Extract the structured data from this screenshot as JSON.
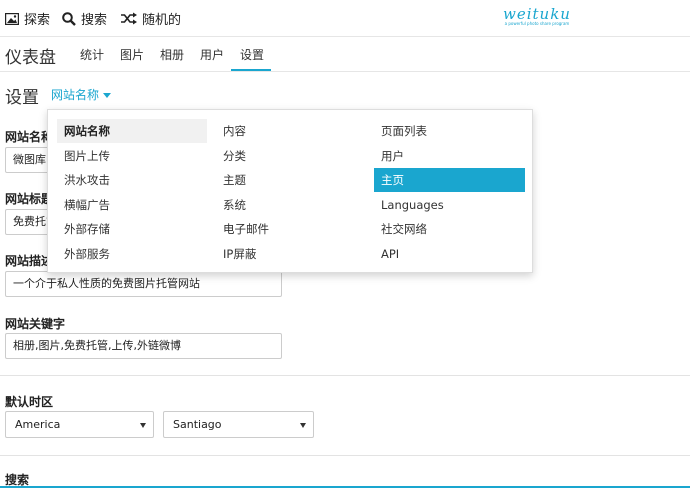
{
  "topnav": {
    "explore": "探索",
    "search": "搜索",
    "random": "随机的"
  },
  "logo": {
    "brand": "weituku",
    "tagline": "a powerful photo share program"
  },
  "subnav": {
    "title": "仪表盘",
    "tabs": [
      "统计",
      "图片",
      "相册",
      "用户",
      "设置"
    ],
    "active_tab": "设置"
  },
  "settings": {
    "title": "设置",
    "section": "网站名称"
  },
  "form": {
    "site_name": {
      "label": "网站名称",
      "value": "微图库"
    },
    "site_title": {
      "label": "网站标题",
      "value": "免费托管"
    },
    "site_desc": {
      "label": "网站描述",
      "value": "一个介于私人性质的免费图片托管网站"
    },
    "site_keywords": {
      "label": "网站关键字",
      "value": "相册,图片,免费托管,上传,外链微博"
    },
    "timezone": {
      "label": "默认时区",
      "region": "America",
      "city": "Santiago"
    },
    "search_label": "搜索"
  },
  "dropdown": {
    "col1": [
      "网站名称",
      "图片上传",
      "洪水攻击",
      "横幅广告",
      "外部存储",
      "外部服务"
    ],
    "col2": [
      "内容",
      "分类",
      "主题",
      "系统",
      "电子邮件",
      "IP屏蔽"
    ],
    "col3": [
      "页面列表",
      "用户",
      "主页",
      "Languages",
      "社交网络",
      "API"
    ],
    "current": "网站名称",
    "hovered": "主页"
  },
  "colors": {
    "accent": "#1aa6cf",
    "text": "#333333"
  },
  "icons": {
    "explore": "image-icon",
    "search": "search-icon",
    "random": "shuffle-icon"
  }
}
